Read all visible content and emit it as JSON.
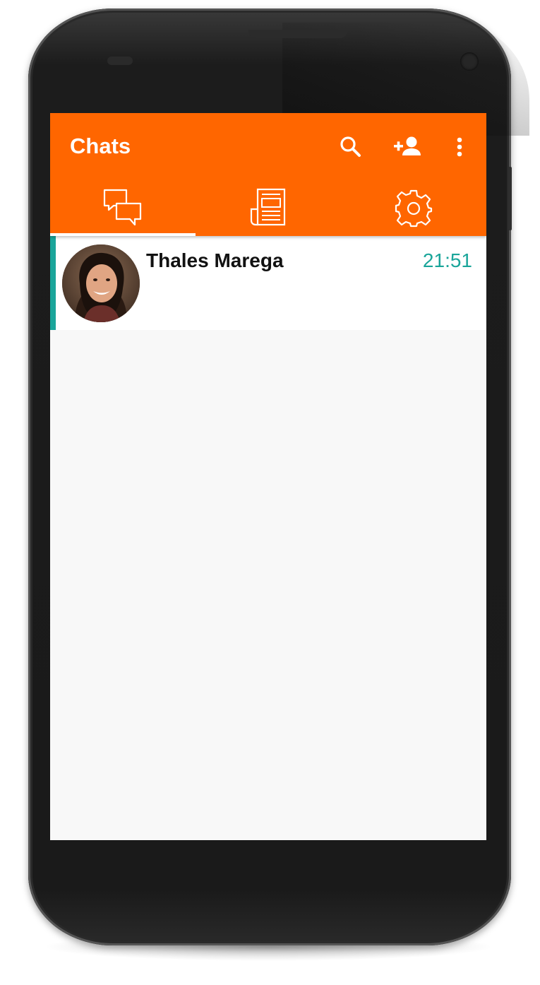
{
  "app_bar": {
    "title": "Chats",
    "color": "#ff6600",
    "actions": [
      {
        "icon": "search-icon"
      },
      {
        "icon": "add-user-icon"
      },
      {
        "icon": "more-vert-icon"
      }
    ]
  },
  "tabs": [
    {
      "icon": "chat-bubbles-icon",
      "selected": true
    },
    {
      "icon": "newspaper-icon",
      "selected": false
    },
    {
      "icon": "gear-icon",
      "selected": false
    }
  ],
  "chats": [
    {
      "name": "Thales Marega",
      "time": "21:51",
      "unread": true,
      "avatar": "avatar-photo"
    }
  ],
  "colors": {
    "accent": "#1aa59a",
    "background": "#f8f8f8"
  }
}
